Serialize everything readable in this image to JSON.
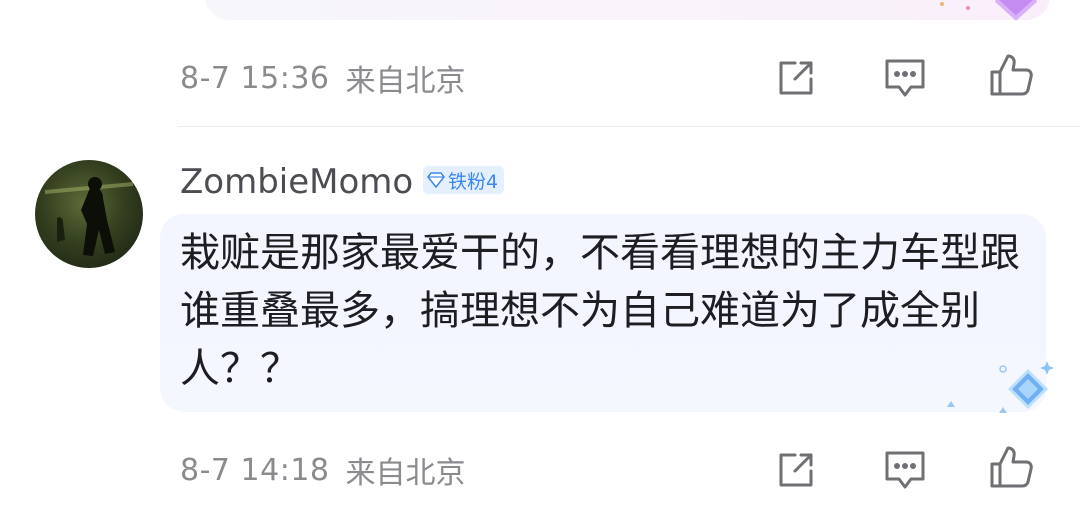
{
  "prev_comment": {
    "time": "8-7 15:36",
    "location": "来自北京"
  },
  "comment": {
    "username": "ZombieMomo",
    "badge": "铁粉4",
    "text": "栽赃是那家最爱干的，不看看理想的主力车型跟谁重叠最多，搞理想不为自己难道为了成全别人？？",
    "time": "8-7 14:18",
    "location": "来自北京"
  },
  "icons": {
    "share": "share-edit-icon",
    "reply": "comment-reply-icon",
    "like": "thumbs-up-icon",
    "badge": "diamond-icon"
  },
  "colors": {
    "meta_text": "#8b8b8f",
    "badge_bg": "#e5f0ff",
    "badge_text": "#3d87f2",
    "bubble_bg": "#f4f6ff"
  }
}
